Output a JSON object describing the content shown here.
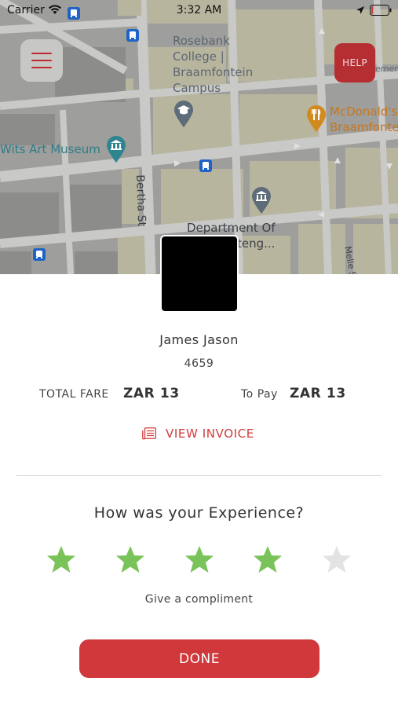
{
  "status_bar": {
    "carrier": "Carrier",
    "time": "3:32 AM",
    "icons": [
      "wifi-icon",
      "bus-stop-icon",
      "location-arrow-icon",
      "battery-icon"
    ]
  },
  "map": {
    "labels": {
      "rosebank_line1": "Rosebank",
      "rosebank_line2": "College |",
      "rosebank_line3": "Braamfontein",
      "rosebank_line4": "Campus",
      "wits_art_museum": "Wits Art Museum",
      "mcdonalds_line1": "McDonald's",
      "mcdonalds_line2": "Braamfontei",
      "bertha_st": "Bertha St",
      "department_line1": "Department Of",
      "department_line2": "teng...",
      "melle_st": "Melle St",
      "ement_fragment": "ement"
    },
    "icons": [
      "bus-stop-icon",
      "graduation-cap-icon",
      "museum-icon",
      "restaurant-icon",
      "government-building-icon"
    ]
  },
  "header": {
    "menu_icon": "hamburger-menu-icon",
    "help_label": "HELP"
  },
  "trip": {
    "driver_name": "James Jason",
    "driver_id": "4659",
    "total_fare_label": "TOTAL FARE",
    "total_fare_value": "ZAR 13",
    "to_pay_label": "To Pay",
    "to_pay_value": "ZAR 13",
    "view_invoice_label": "VIEW INVOICE",
    "invoice_icon": "receipt-icon"
  },
  "rating": {
    "question": "How was your Experience?",
    "max_stars": 5,
    "value": 4,
    "filled_color": "#7ac35a",
    "empty_color": "#e3e3e3",
    "compliment_label": "Give a compliment"
  },
  "actions": {
    "done_label": "DONE"
  },
  "colors": {
    "accent_red": "#d0383b",
    "help_red": "#b52e32",
    "invoice_red": "#d03a3a"
  }
}
